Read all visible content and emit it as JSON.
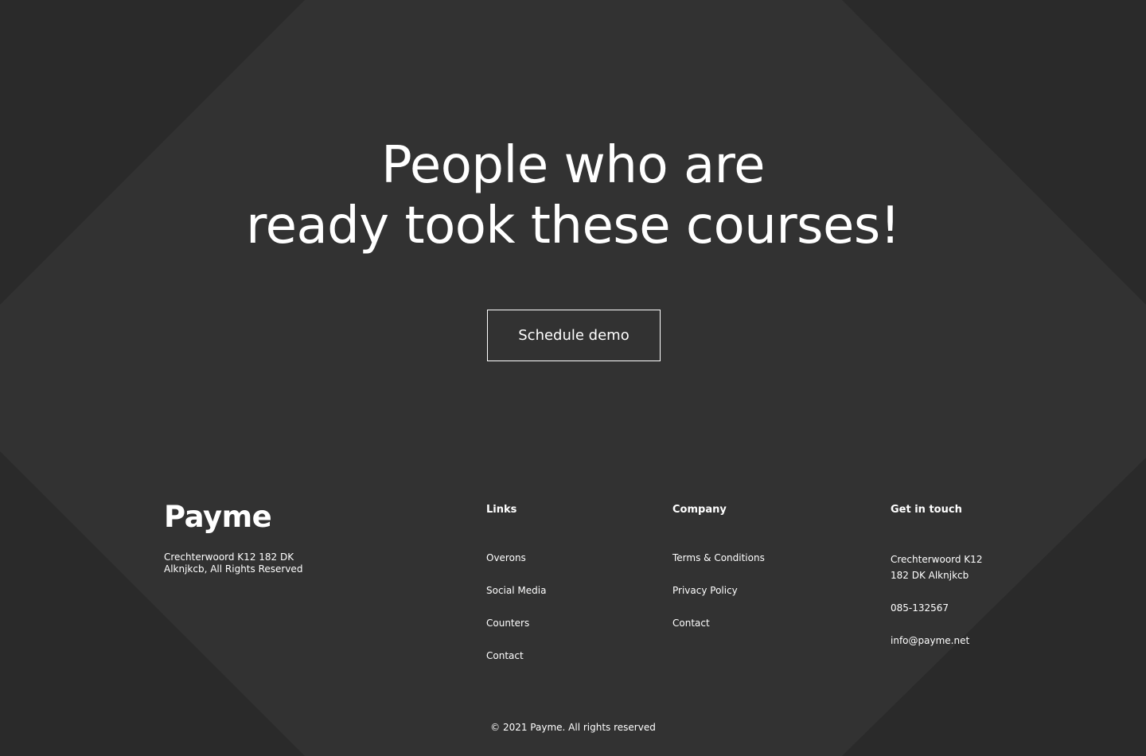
{
  "colors": {
    "background_dark": "#2a2a2a",
    "background_diamond": "#323232",
    "text": "#ffffff"
  },
  "hero": {
    "heading_line1": "People who are",
    "heading_line2": "ready took these courses!",
    "cta_label": "Schedule demo"
  },
  "footer": {
    "brand": {
      "logo": "Payme",
      "address_line1": "Crechterwoord K12 182 DK",
      "address_line2": "Alknjkcb, All Rights Reserved"
    },
    "links": {
      "heading": "Links",
      "items": [
        "Overons",
        "Social Media",
        "Counters",
        "Contact"
      ]
    },
    "company": {
      "heading": "Company",
      "items": [
        "Terms & Conditions",
        "Privacy Policy",
        "Contact"
      ]
    },
    "contact": {
      "heading": "Get in touch",
      "address_line1": "Crechterwoord K12",
      "address_line2": "182 DK Alknjkcb",
      "phone": "085-132567",
      "email": "info@payme.net"
    },
    "copyright": "© 2021 Payme. All rights reserved"
  }
}
